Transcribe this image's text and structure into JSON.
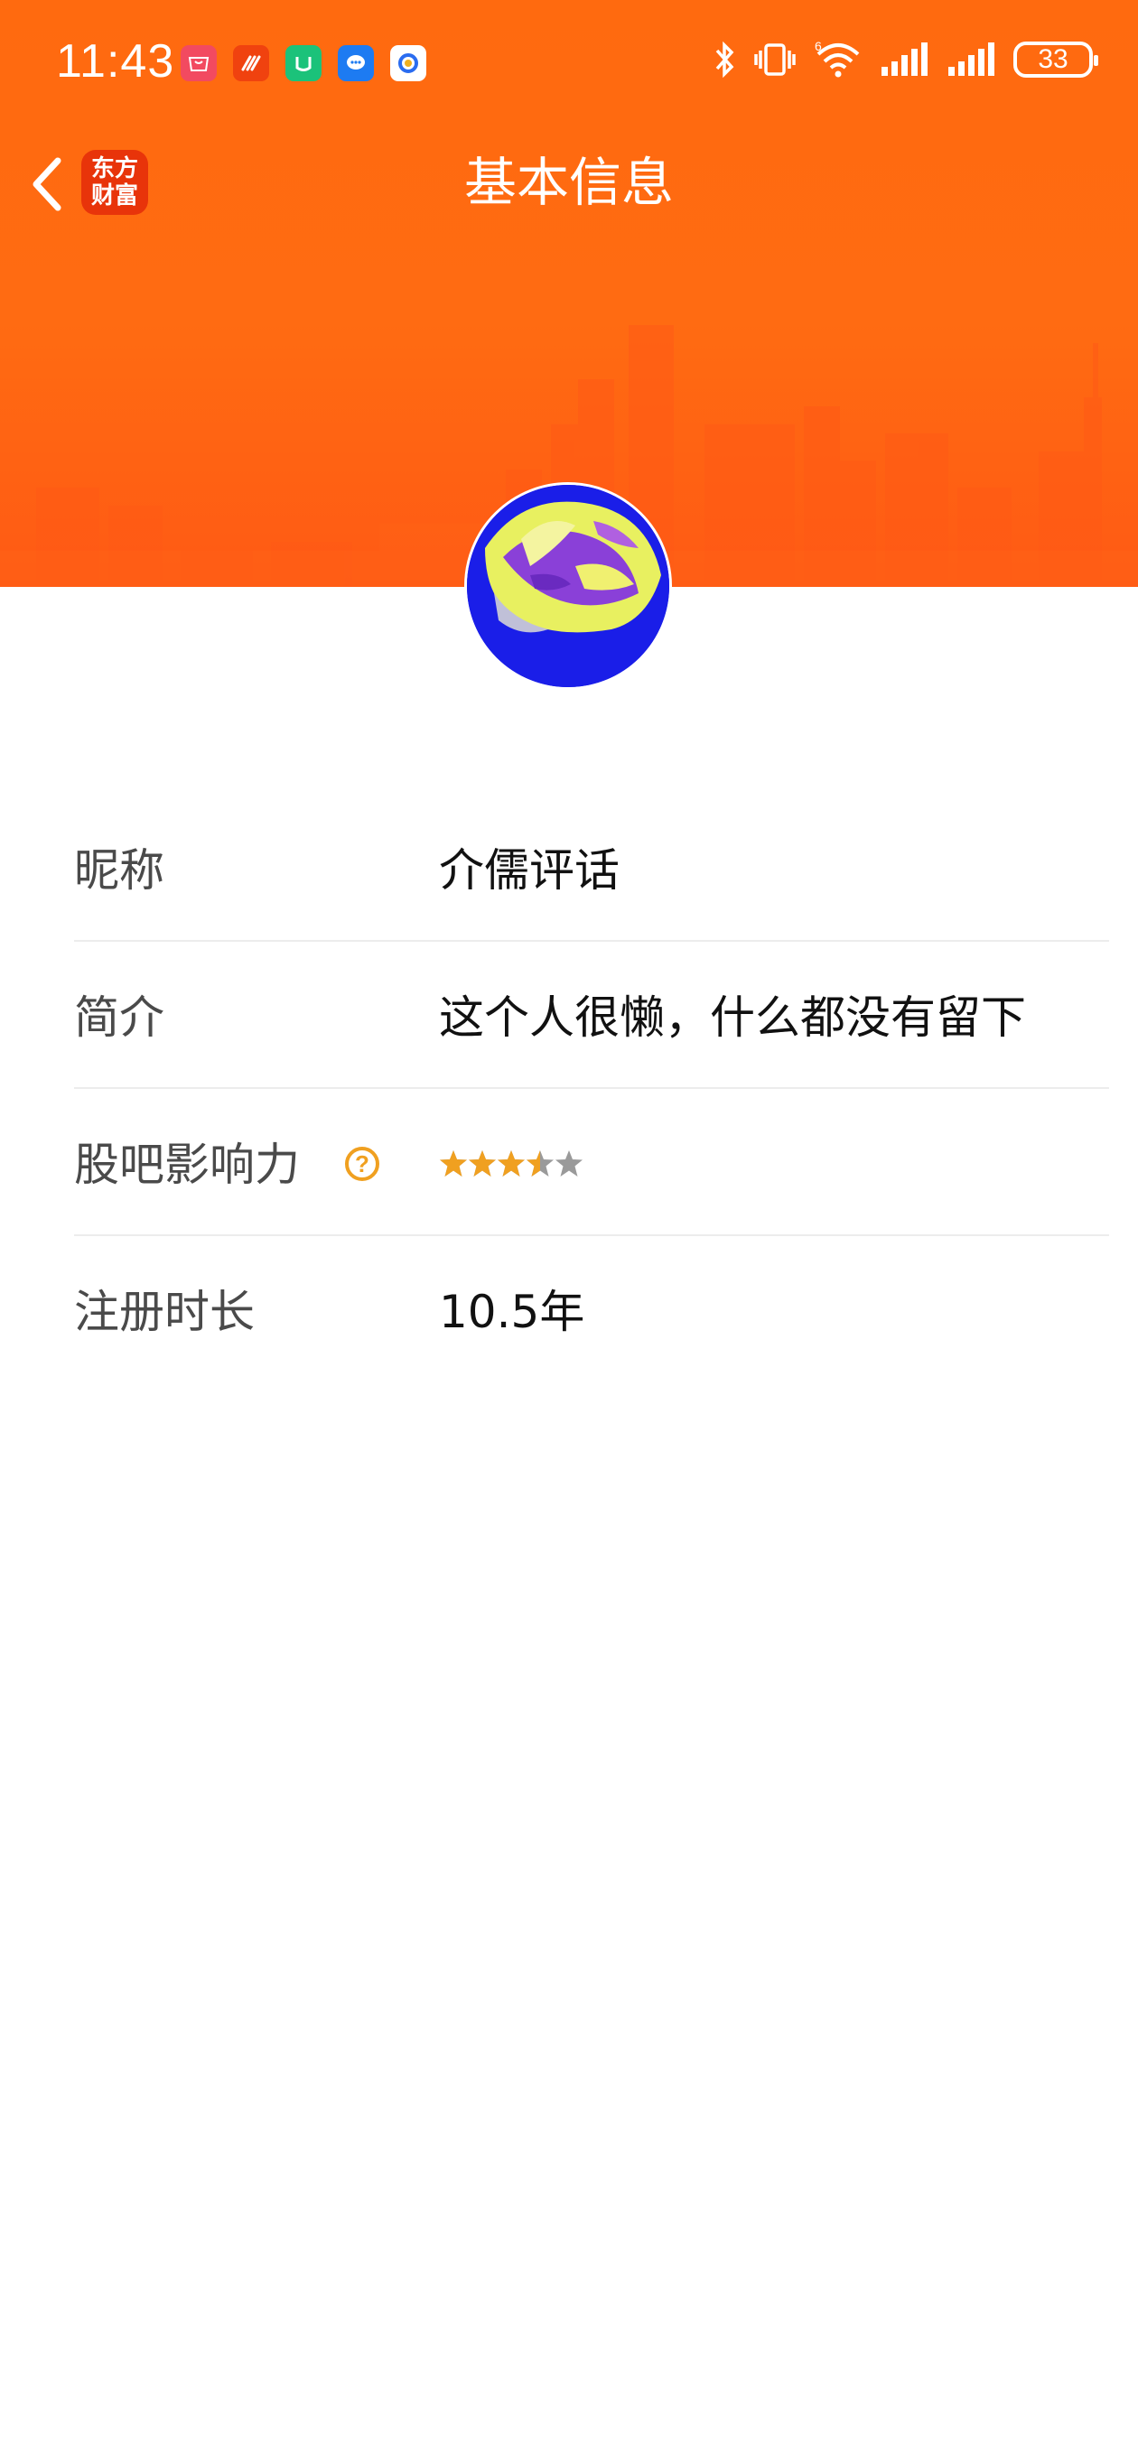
{
  "status_bar": {
    "time": "11:43",
    "notification_icons": [
      "huawei-appgallery-icon",
      "feishu-icon",
      "mi-icon",
      "message-icon",
      "qq-browser-icon"
    ],
    "system_icons": [
      "bluetooth-icon",
      "vibrate-icon",
      "wifi-icon",
      "signal-icon",
      "signal-icon"
    ],
    "battery": "33"
  },
  "header": {
    "title": "基本信息",
    "brand_line1": "东方",
    "brand_line2": "财富"
  },
  "colors": {
    "banner": "#ff6a0f",
    "accent": "#f0a020",
    "brand": "#e8340a"
  },
  "profile": {
    "rows": [
      {
        "label": "昵称",
        "value": "介儒评话"
      },
      {
        "label": "简介",
        "value": "这个人很懒，什么都没有留下"
      },
      {
        "label": "股吧影响力",
        "help": "?",
        "rating": 3.5,
        "rating_max": 5
      },
      {
        "label": "注册时长",
        "value": "10.5年"
      }
    ]
  }
}
